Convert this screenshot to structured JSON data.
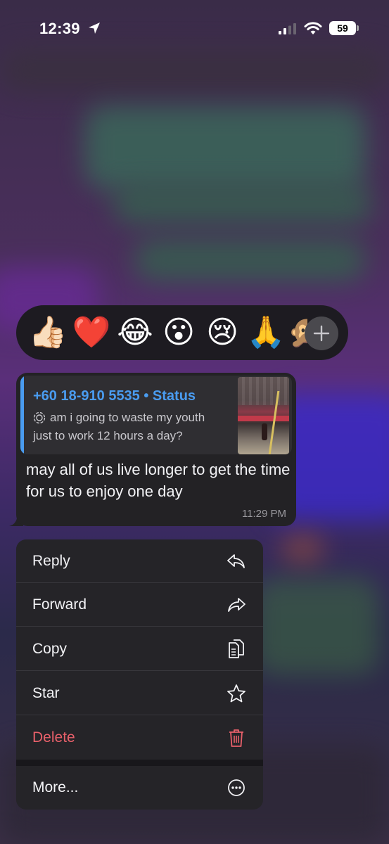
{
  "status_bar": {
    "time": "12:39",
    "battery": "59"
  },
  "reactions": {
    "items": [
      {
        "name": "thumbs-up",
        "glyph": "👍🏻"
      },
      {
        "name": "red-heart",
        "glyph": "❤️"
      },
      {
        "name": "tears-of-joy",
        "glyph": "😂"
      },
      {
        "name": "surprised",
        "glyph": "😮"
      },
      {
        "name": "crying",
        "glyph": "😢"
      },
      {
        "name": "folded-hands",
        "glyph": "🙏"
      },
      {
        "name": "monkey",
        "glyph": "🙊"
      }
    ],
    "more_label": "+"
  },
  "message": {
    "quote_sender": "+60 18-910 5535 • Status",
    "quote_line1": "am i going to waste my youth",
    "quote_line2": "just to work 12 hours a day?",
    "text": "may all of us live longer to get the time for us to enjoy one day",
    "time": "11:29 PM"
  },
  "menu": {
    "reply": "Reply",
    "forward": "Forward",
    "copy": "Copy",
    "star": "Star",
    "delete": "Delete",
    "more": "More..."
  },
  "colors": {
    "accent": "#4a9cf0",
    "danger": "#e8606a",
    "bubble": "#232225",
    "menu": "#252428"
  }
}
